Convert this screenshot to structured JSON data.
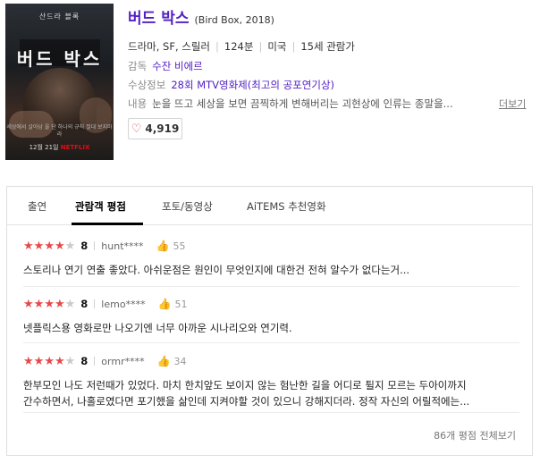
{
  "movie": {
    "title": "버드 박스",
    "original_title": "(Bird Box, 2018)",
    "genre": "드라마, SF, 스릴러",
    "runtime": "124분",
    "country": "미국",
    "rating": "15세 관람가",
    "director_label": "감독",
    "director": "수잔 비에르",
    "award_label": "수상정보",
    "award": "28회 MTV영화제(최고의 공포연기상)",
    "plot_label": "내용",
    "plot": "눈을 뜨고 세상을 보면 끔찍하게 변해버리는 괴현상에 인류는 종말을...",
    "more_label": "더보기",
    "likes": "4,919",
    "heart_icon": "heart-icon"
  },
  "poster": {
    "top_text": "산드라 블록",
    "title_text": "버드 박스",
    "tagline": "세상에서 살아남 을 단 하나의 규칙 절대 보지마라",
    "date": "12월 21일",
    "brand": "NETFLIX"
  },
  "tabs": [
    {
      "label": "출연"
    },
    {
      "label": "관람객 평점"
    },
    {
      "label": "포토/동영상"
    },
    {
      "label": "AiTEMS 추천영화"
    }
  ],
  "reviews": [
    {
      "stars": 4,
      "score": "8",
      "nick": "hunt****",
      "likes": "55",
      "text": "스토리나 연기 연출 좋았다. 아쉬운점은 원인이 무엇인지에 대한건 전혀 알수가 없다는거..."
    },
    {
      "stars": 4,
      "score": "8",
      "nick": "lemo****",
      "likes": "51",
      "text": "넷플릭스용 영화로만 나오기엔 너무 아까운 시나리오와 연기력."
    },
    {
      "stars": 4,
      "score": "8",
      "nick": "ormr****",
      "likes": "34",
      "text": "한부모인 나도 저런때가 있었다. 마치 한치앞도 보이지 않는 험난한 길을 어디로 튈지 모르는 두아이까지",
      "text2": "간수하면서, 나홀로였다면 포기했을 삶인데 지켜야할 것이 있으니 강해지더라. 정작 자신의 어릴적에는..."
    }
  ],
  "all_reviews_label": "86개 평점 전체보기",
  "colors": {
    "accent": "#5320c4",
    "star": "#e84848",
    "heart": "#e0414f"
  }
}
